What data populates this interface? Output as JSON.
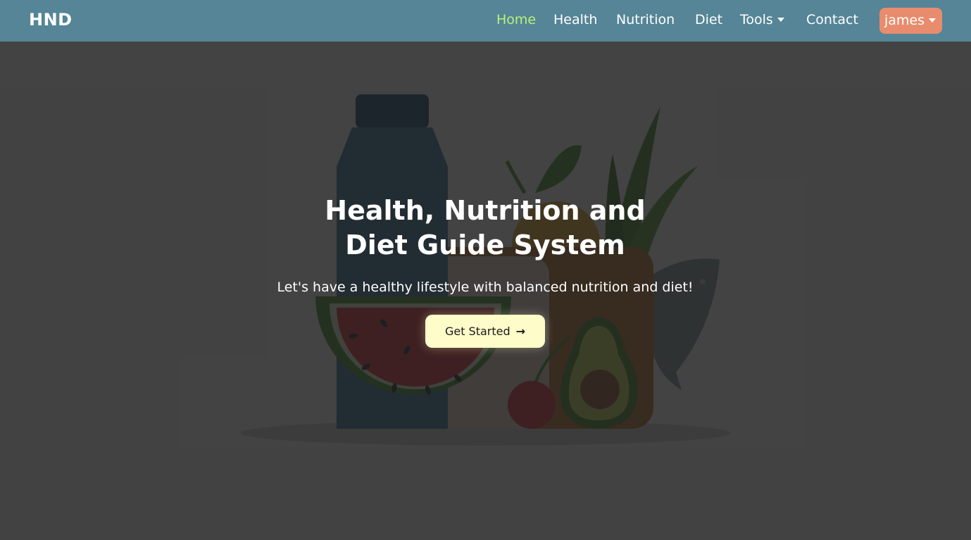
{
  "nav": {
    "brand": "HND",
    "links": [
      {
        "label": "Home",
        "active": true
      },
      {
        "label": "Health"
      },
      {
        "label": "Nutrition"
      },
      {
        "label": "Diet"
      },
      {
        "label": "Tools",
        "dropdown": true
      },
      {
        "label": "Contact"
      }
    ],
    "user": {
      "label": "james",
      "dropdown": true
    }
  },
  "hero": {
    "title_line1": "Health, Nutrition and",
    "title_line2": "Diet Guide System",
    "subtitle": "Let's have a healthy lifestyle with balanced nutrition and diet!",
    "cta_label": "Get Started",
    "cta_icon": "arrow-right-icon"
  },
  "colors": {
    "navbar_bg": "#558597",
    "active_link": "#b8f27a",
    "user_button_bg": "#e88c6d",
    "cta_bg": "#fefcc9",
    "overlay": "#444444"
  }
}
